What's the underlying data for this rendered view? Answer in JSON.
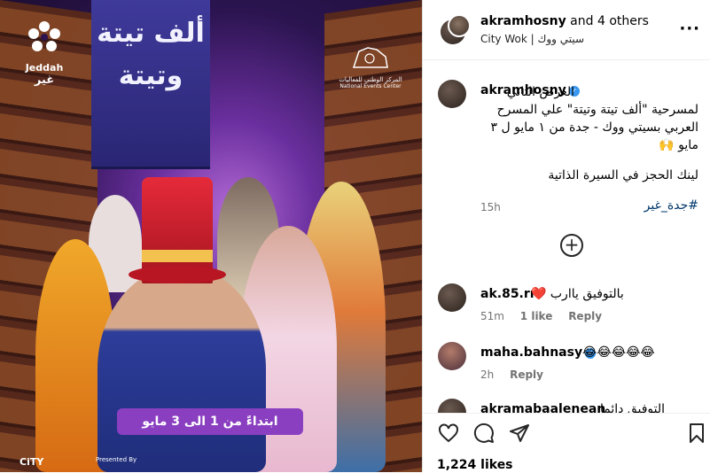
{
  "poster": {
    "banner_title": "ألف تيتة وتيتة",
    "jeddah_logo_en": "Jeddah",
    "jeddah_logo_ar": "غير",
    "nec_ar": "المركز الوطني للفعاليات",
    "nec_en": "National Events Center",
    "date_text": "ابتداءً من 1 الى 3 مايو",
    "presented_by": "Presented By",
    "city_logo": "CiTY"
  },
  "header": {
    "username": "akramhosny",
    "and_others": "and 4 others",
    "location": "City Wok | سيتي ووك",
    "more": "···"
  },
  "caption": {
    "username": "akramhosny",
    "line1": "العرض التاني لمسرحية \"ألف تيتة وتيتة\" علي المسرح العربي بسيتي ووك - جدة من ١ مايو ل ٣ مايو 🙌",
    "line2": "لينك الحجز في السيرة الذاتية",
    "hashtag": "#جدة_غير",
    "time": "15h"
  },
  "comments": [
    {
      "username": "ak.85.rr",
      "text": "بالتوفيق ياارب ❤️",
      "time": "51m",
      "likes": "1 like",
      "reply": "Reply"
    },
    {
      "username": "maha.bahnasy",
      "text": "😂😂😂😂😂",
      "time": "2h",
      "reply": "Reply"
    },
    {
      "username": "akramabaalenean",
      "text": "التوفيق دائما"
    }
  ],
  "footer": {
    "likes": "1,224 likes"
  },
  "icons": [
    "heart-icon",
    "comment-icon",
    "share-icon",
    "save-icon",
    "add-comment-icon",
    "verified-icon"
  ]
}
